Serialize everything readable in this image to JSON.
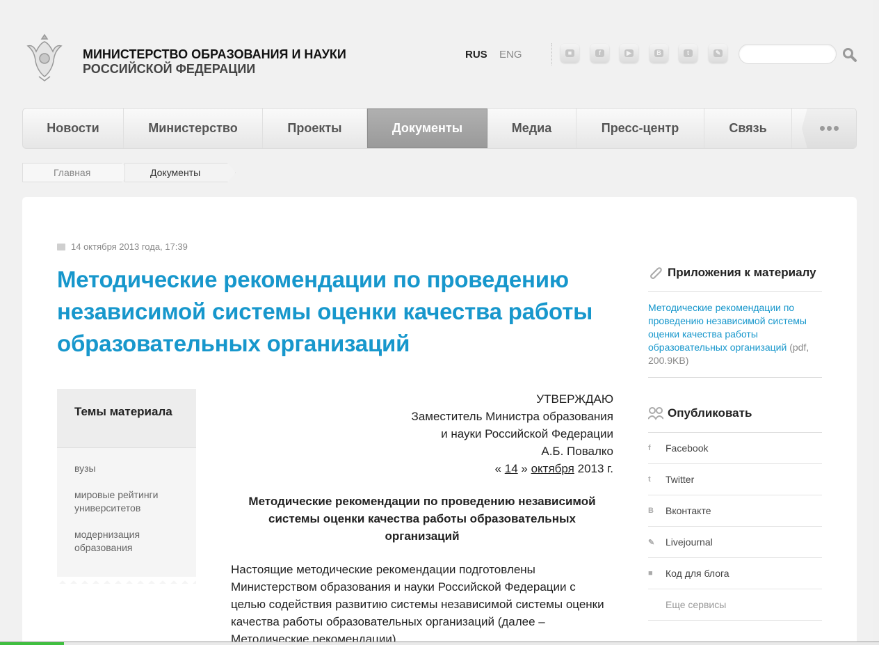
{
  "header": {
    "org_line1": "МИНИСТЕРСТВО ОБРАЗОВАНИЯ И НАУКИ",
    "org_line2": "РОССИЙСКОЙ ФЕДЕРАЦИИ",
    "lang_rus": "RUS",
    "lang_eng": "ENG",
    "social_icons": [
      "chat-icon",
      "facebook-icon",
      "video-icon",
      "vkontakte-icon",
      "twitter-icon",
      "livejournal-icon"
    ],
    "search_placeholder": ""
  },
  "nav": {
    "items": [
      {
        "label": "Новости",
        "active": false
      },
      {
        "label": "Министерство",
        "active": false
      },
      {
        "label": "Проекты",
        "active": false
      },
      {
        "label": "Документы",
        "active": true
      },
      {
        "label": "Медиа",
        "active": false
      },
      {
        "label": "Пресс-центр",
        "active": false
      },
      {
        "label": "Связь",
        "active": false
      }
    ]
  },
  "breadcrumb": {
    "home": "Главная",
    "current": "Документы"
  },
  "article": {
    "date": "14 октября 2013 года, 17:39",
    "title": "Методические рекомендации по проведению независимой системы оценки качества работы образовательных организаций",
    "approve_lines": [
      "УТВЕРЖДАЮ",
      "Заместитель Министра образования",
      "и науки Российской Федерации",
      "А.Б. Повалко"
    ],
    "approve_date_open": "«",
    "approve_day": "14",
    "approve_date_mid": "»",
    "approve_month": "октября",
    "approve_year": "2013 г.",
    "doc_title": "Методические рекомендации по проведению независимой системы оценки качества работы образовательных организаций",
    "paragraph": "Настоящие методические рекомендации подготовлены Министерством образования и науки Российской Федерации с целью содействия развитию системы независимой системы оценки качества работы образовательных организаций (далее – Методические рекомендации)."
  },
  "topics": {
    "heading": "Темы материала",
    "items": [
      "вузы",
      "мировые рейтинги университетов",
      "модернизация образования"
    ]
  },
  "attachments": {
    "heading": "Приложения к материалу",
    "link": "Методические рекомендации по проведению независимой системы оценки качества работы образовательных организаций",
    "meta": "(pdf, 200.9KB)"
  },
  "publish": {
    "heading": "Опубликовать",
    "items": [
      "Facebook",
      "Twitter",
      "Вконтакте",
      "Livejournal",
      "Код для блога"
    ],
    "more": "Еще сервисы"
  },
  "colors": {
    "accent": "#1797cc",
    "nav_active": "#a4a4a4"
  }
}
